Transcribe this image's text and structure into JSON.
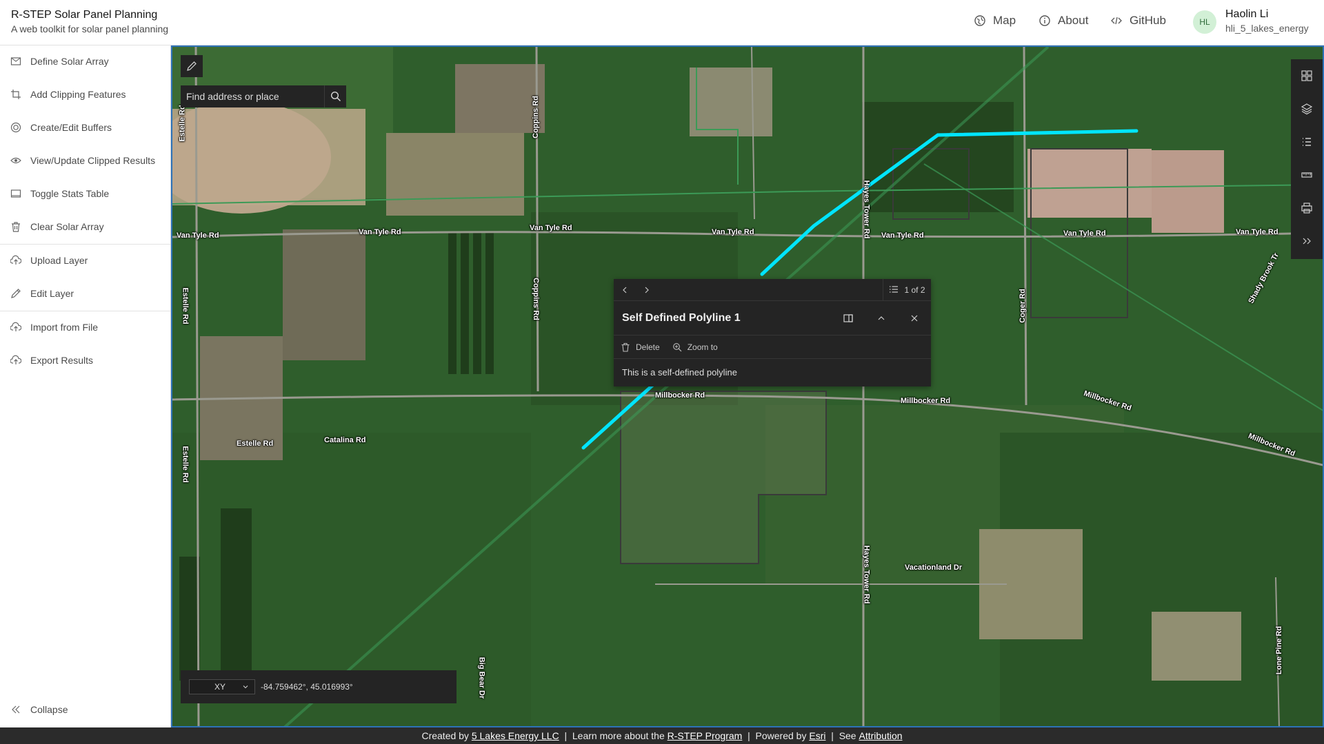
{
  "header": {
    "title": "R-STEP Solar Panel Planning",
    "subtitle": "A web toolkit for solar panel planning",
    "nav": [
      {
        "label": "Map",
        "icon": "map-icon"
      },
      {
        "label": "About",
        "icon": "info-icon"
      },
      {
        "label": "GitHub",
        "icon": "code-icon"
      }
    ],
    "user": {
      "initials": "HL",
      "name": "Haolin Li",
      "handle": "hli_5_lakes_energy"
    }
  },
  "sidebar": {
    "items": [
      {
        "label": "Define Solar Array",
        "icon": "solar-array-icon"
      },
      {
        "label": "Add Clipping Features",
        "icon": "crop-icon"
      },
      {
        "label": "Create/Edit Buffers",
        "icon": "buffer-icon"
      },
      {
        "label": "View/Update Clipped Results",
        "icon": "eye-icon"
      },
      {
        "label": "Toggle Stats Table",
        "icon": "table-icon"
      },
      {
        "label": "Clear Solar Array",
        "icon": "trash-icon"
      },
      {
        "label": "Upload Layer",
        "icon": "upload-icon"
      },
      {
        "label": "Edit Layer",
        "icon": "pencil-icon"
      },
      {
        "label": "Import from File",
        "icon": "import-icon"
      },
      {
        "label": "Export Results",
        "icon": "export-icon"
      }
    ],
    "collapse_label": "Collapse"
  },
  "map": {
    "search_placeholder": "Find address or place",
    "popup": {
      "count": "1 of 2",
      "title": "Self Defined Polyline 1",
      "delete_label": "Delete",
      "zoom_label": "Zoom to",
      "body": "This is a self-defined polyline"
    },
    "coordinates": {
      "format": "XY",
      "value": "-84.759462°, 45.016993°"
    },
    "road_labels": [
      "Van Tyle Rd",
      "Van Tyle Rd",
      "Van Tyle Rd",
      "Van Tyle Rd",
      "Van Tyle Rd",
      "Van Tyle Rd",
      "Van Tyle Rd",
      "Estelle Rd",
      "Estelle Rd",
      "Estelle Rd",
      "Estelle Rd",
      "Catalina Rd",
      "Coppins Rd",
      "Coppins Rd",
      "Hayes Tower Rd",
      "Hayes Tower Rd",
      "Coger Rd",
      "Millbocker Rd",
      "Millbocker Rd",
      "Millbocker Rd",
      "Millbocker Rd",
      "Vacationland Dr",
      "Big Bear Dr",
      "Lone Pine Rd",
      "Shady Brook Tr"
    ],
    "colors": {
      "highlight_line": "#00e5ff",
      "toolbar": "#242424"
    }
  },
  "footer": {
    "created_by": "Created by ",
    "company": "5 Lakes Energy LLC",
    "sep1": "  |  ",
    "learn_more": "Learn more about the ",
    "program": "R-STEP Program",
    "sep2": "  |  ",
    "powered_by": "Powered by ",
    "esri": "Esri",
    "sep3": "  |  ",
    "see": "See ",
    "attribution": "Attribution"
  }
}
